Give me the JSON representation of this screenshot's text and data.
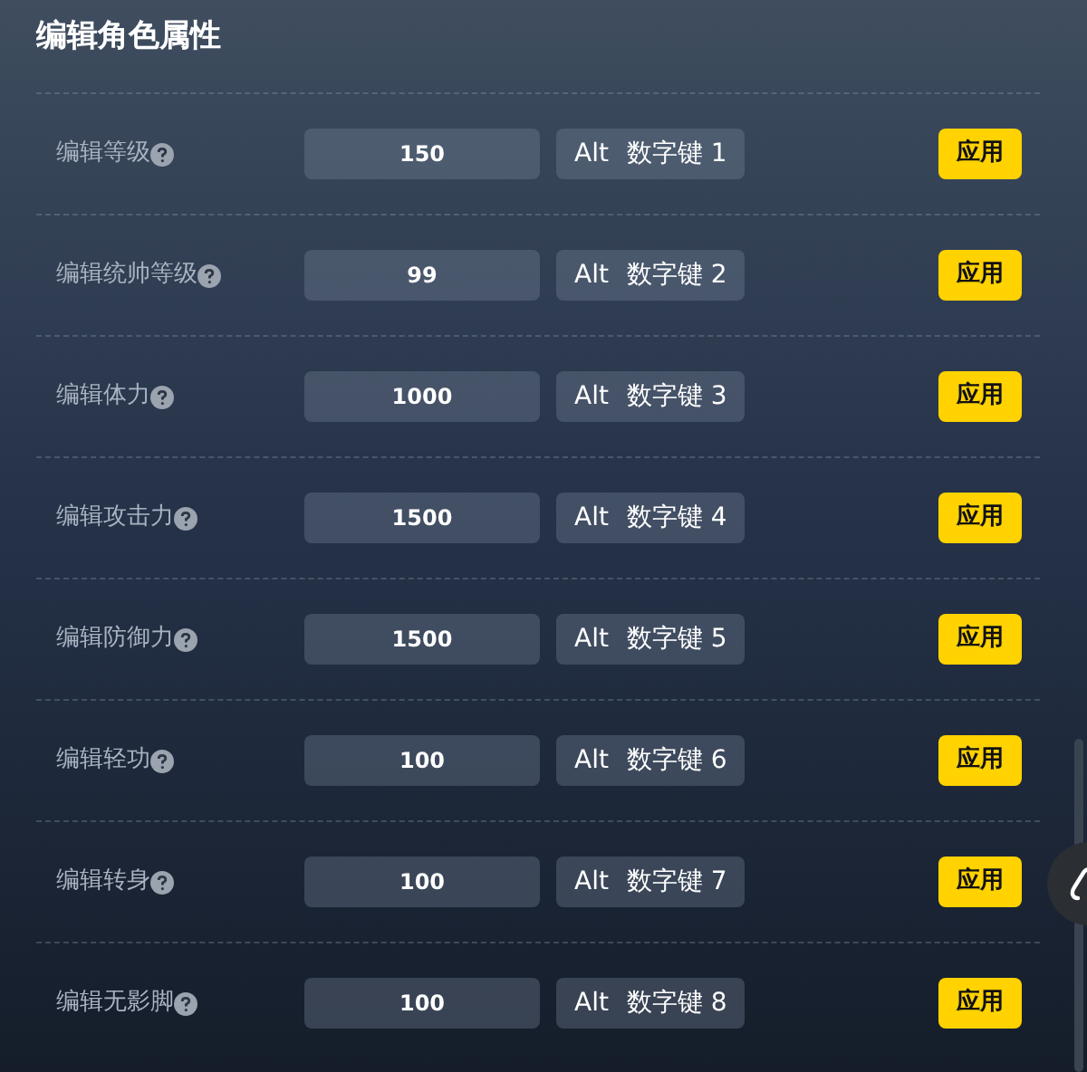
{
  "title": "编辑角色属性",
  "rows": [
    {
      "label": "编辑等级",
      "value": "150",
      "hotkey_mod": "Alt",
      "hotkey_key": "数字键 1",
      "button": "应用"
    },
    {
      "label": "编辑统帅等级",
      "value": "99",
      "hotkey_mod": "Alt",
      "hotkey_key": "数字键 2",
      "button": "应用"
    },
    {
      "label": "编辑体力",
      "value": "1000",
      "hotkey_mod": "Alt",
      "hotkey_key": "数字键 3",
      "button": "应用"
    },
    {
      "label": "编辑攻击力",
      "value": "1500",
      "hotkey_mod": "Alt",
      "hotkey_key": "数字键 4",
      "button": "应用"
    },
    {
      "label": "编辑防御力",
      "value": "1500",
      "hotkey_mod": "Alt",
      "hotkey_key": "数字键 5",
      "button": "应用"
    },
    {
      "label": "编辑轻功",
      "value": "100",
      "hotkey_mod": "Alt",
      "hotkey_key": "数字键 6",
      "button": "应用"
    },
    {
      "label": "编辑转身",
      "value": "100",
      "hotkey_mod": "Alt",
      "hotkey_key": "数字键 7",
      "button": "应用"
    },
    {
      "label": "编辑无影脚",
      "value": "100",
      "hotkey_mod": "Alt",
      "hotkey_key": "数字键 8",
      "button": "应用"
    }
  ]
}
